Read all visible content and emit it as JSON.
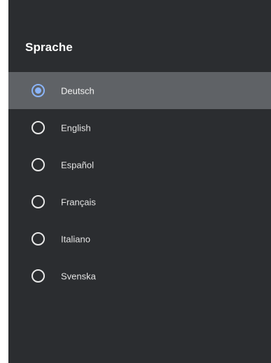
{
  "dialog": {
    "title": "Sprache",
    "selected_index": 0,
    "options": [
      {
        "label": "Deutsch"
      },
      {
        "label": "English"
      },
      {
        "label": "Español"
      },
      {
        "label": "Français"
      },
      {
        "label": "Italiano"
      },
      {
        "label": "Svenska"
      }
    ]
  },
  "colors": {
    "background": "#2b2d30",
    "highlight": "#5f6266",
    "accent": "#8ab4f8"
  },
  "icons": {
    "selected": "radio-checked-icon",
    "unselected": "radio-unchecked-icon"
  }
}
